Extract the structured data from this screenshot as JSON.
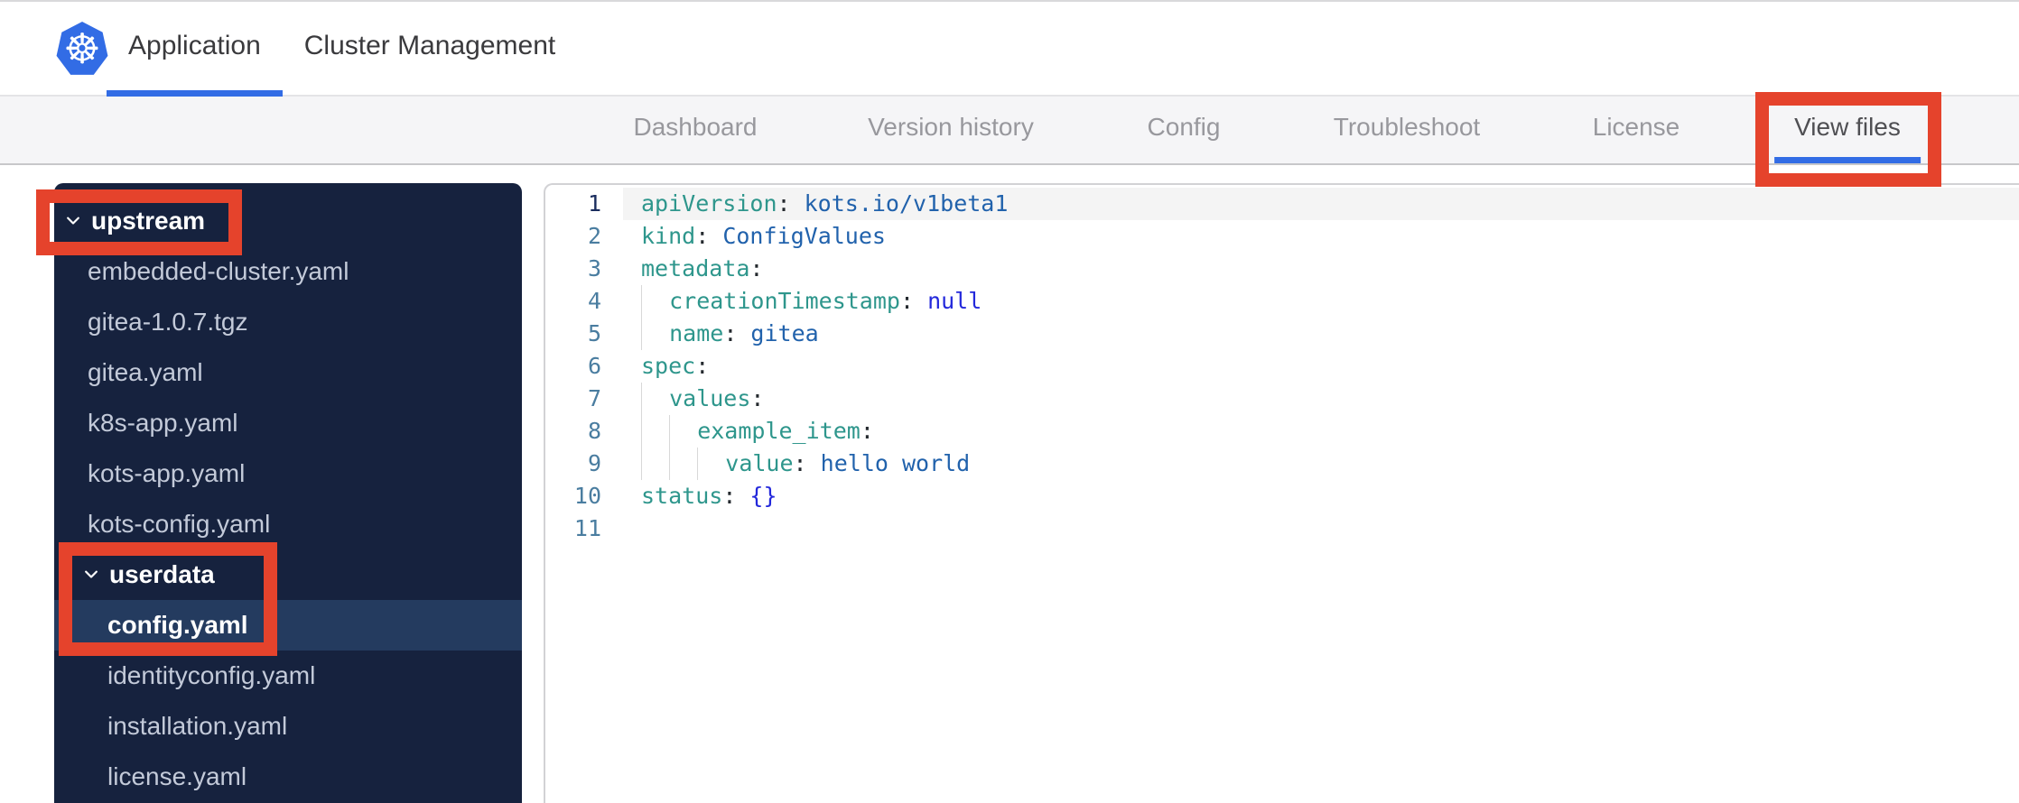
{
  "topbar": {
    "logo_glyph": "☸",
    "tabs": [
      {
        "label": "Application",
        "active": true
      },
      {
        "label": "Cluster Management",
        "active": false
      }
    ]
  },
  "app_nav": {
    "tabs": [
      {
        "label": "Dashboard",
        "active": false
      },
      {
        "label": "Version history",
        "active": false
      },
      {
        "label": "Config",
        "active": false
      },
      {
        "label": "Troubleshoot",
        "active": false
      },
      {
        "label": "License",
        "active": false
      },
      {
        "label": "View files",
        "active": true
      }
    ]
  },
  "file_tree": {
    "items": [
      {
        "type": "folder",
        "label": "upstream",
        "level": 0,
        "expanded": true
      },
      {
        "type": "file",
        "label": "embedded-cluster.yaml",
        "level": 1
      },
      {
        "type": "file",
        "label": "gitea-1.0.7.tgz",
        "level": 1
      },
      {
        "type": "file",
        "label": "gitea.yaml",
        "level": 1
      },
      {
        "type": "file",
        "label": "k8s-app.yaml",
        "level": 1
      },
      {
        "type": "file",
        "label": "kots-app.yaml",
        "level": 1
      },
      {
        "type": "file",
        "label": "kots-config.yaml",
        "level": 1
      },
      {
        "type": "folder",
        "label": "userdata",
        "level": 1,
        "expanded": true
      },
      {
        "type": "file",
        "label": "config.yaml",
        "level": 2,
        "selected": true
      },
      {
        "type": "file",
        "label": "identityconfig.yaml",
        "level": 2
      },
      {
        "type": "file",
        "label": "installation.yaml",
        "level": 2
      },
      {
        "type": "file",
        "label": "license.yaml",
        "level": 2
      }
    ]
  },
  "editor": {
    "language": "yaml",
    "lines": [
      {
        "n": "1",
        "indent": 0,
        "active": true,
        "tokens": [
          [
            "key",
            "apiVersion"
          ],
          [
            "punc",
            ":"
          ],
          [
            "val",
            " kots.io/v1beta1"
          ]
        ]
      },
      {
        "n": "2",
        "indent": 0,
        "tokens": [
          [
            "key",
            "kind"
          ],
          [
            "punc",
            ":"
          ],
          [
            "val",
            " ConfigValues"
          ]
        ]
      },
      {
        "n": "3",
        "indent": 0,
        "tokens": [
          [
            "key",
            "metadata"
          ],
          [
            "punc",
            ":"
          ]
        ]
      },
      {
        "n": "4",
        "indent": 1,
        "tokens": [
          [
            "key",
            "creationTimestamp"
          ],
          [
            "punc",
            ":"
          ],
          [
            "atom",
            " null"
          ]
        ]
      },
      {
        "n": "5",
        "indent": 1,
        "tokens": [
          [
            "key",
            "name"
          ],
          [
            "punc",
            ":"
          ],
          [
            "val",
            " gitea"
          ]
        ]
      },
      {
        "n": "6",
        "indent": 0,
        "tokens": [
          [
            "key",
            "spec"
          ],
          [
            "punc",
            ":"
          ]
        ]
      },
      {
        "n": "7",
        "indent": 1,
        "tokens": [
          [
            "key",
            "values"
          ],
          [
            "punc",
            ":"
          ]
        ]
      },
      {
        "n": "8",
        "indent": 2,
        "tokens": [
          [
            "key",
            "example_item"
          ],
          [
            "punc",
            ":"
          ]
        ]
      },
      {
        "n": "9",
        "indent": 3,
        "tokens": [
          [
            "key",
            "value"
          ],
          [
            "punc",
            ":"
          ],
          [
            "val",
            " hello world"
          ]
        ]
      },
      {
        "n": "10",
        "indent": 0,
        "tokens": [
          [
            "key",
            "status"
          ],
          [
            "punc",
            ":"
          ],
          [
            "atom",
            " {}"
          ]
        ]
      },
      {
        "n": "11",
        "indent": 0,
        "tokens": []
      }
    ]
  },
  "annotations": {
    "color": "#E5432C",
    "boxes": [
      {
        "target": "view-files-tab"
      },
      {
        "target": "upstream-folder"
      },
      {
        "target": "userdata-config-yaml-selection"
      }
    ]
  },
  "colors": {
    "accent_blue": "#326CE5",
    "sidebar_bg": "#16223E",
    "sidebar_selected_bg": "#243B5F",
    "annotation_red": "#E5432C"
  }
}
